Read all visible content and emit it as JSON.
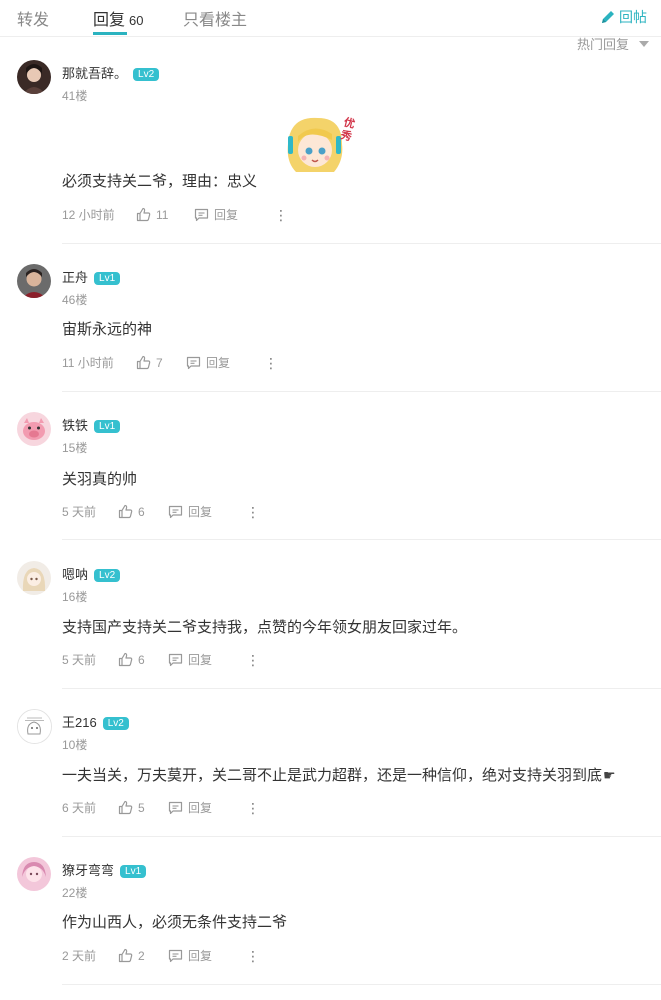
{
  "tabs": [
    {
      "label": "转发"
    },
    {
      "label": "回复",
      "count": "60"
    },
    {
      "label": "只看楼主"
    }
  ],
  "reply_post_label": "回帖",
  "sort_label": "热门回复",
  "reply_label": "回复",
  "comments": [
    {
      "name": "那就吾辞。",
      "level": "Lv2",
      "floor": "41楼",
      "text": "必须支持关二爷，理由：忠义",
      "time": "12 小时前",
      "likes": "11",
      "sticker_text": "优秀"
    },
    {
      "name": "正舟",
      "level": "Lv1",
      "floor": "46楼",
      "text": "宙斯永远的神",
      "time": "11 小时前",
      "likes": "7"
    },
    {
      "name": "铁铁",
      "level": "Lv1",
      "floor": "15楼",
      "text": "关羽真的帅",
      "time": "5 天前",
      "likes": "6"
    },
    {
      "name": "嗯呐",
      "level": "Lv2",
      "floor": "16楼",
      "text": "支持国产支持关二爷支持我，点赞的今年领女朋友回家过年。",
      "time": "5 天前",
      "likes": "6"
    },
    {
      "name": "王216",
      "level": "Lv2",
      "floor": "10楼",
      "text": "一夫当关，万夫莫开，关二哥不止是武力超群，还是一种信仰，绝对支持关羽到底",
      "time": "6 天前",
      "likes": "5"
    },
    {
      "name": "獠牙弯弯",
      "level": "Lv1",
      "floor": "22楼",
      "text": "作为山西人，必须无条件支持二爷",
      "time": "2 天前",
      "likes": "2"
    }
  ],
  "colors": {
    "accent": "#2bb3c0",
    "level_badge": "#35c0cf"
  }
}
